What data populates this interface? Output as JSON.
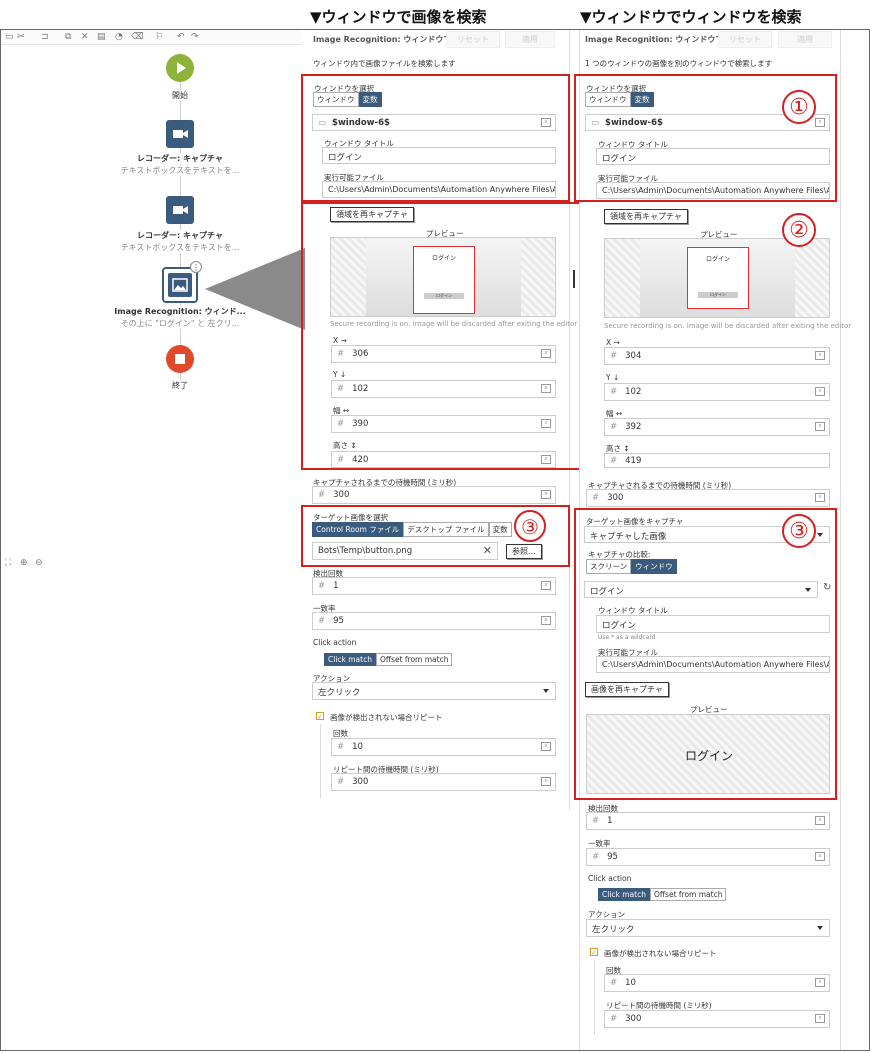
{
  "headers": {
    "left": "▼ウィンドウで画像を検索",
    "right": "▼ウィンドウでウィンドウを検索"
  },
  "canvas": {
    "nodes": [
      {
        "title": "開始",
        "subtitle": ""
      },
      {
        "title": "レコーダー: キャプチャ",
        "subtitle": "テキストボックスをテキストを..."
      },
      {
        "title": "レコーダー: キャプチャ",
        "subtitle": "テキストボックスをテキストを..."
      },
      {
        "title": "Image Recognition: ウィンド...",
        "subtitle": "その上に \"ログイン\" と 左クリ..."
      },
      {
        "title": "終了",
        "subtitle": ""
      }
    ],
    "colors": {
      "start": "#8db33a",
      "end": "#e04a2a",
      "node": "#3a5a7e"
    }
  },
  "left": {
    "title": "Image Recognition: ウィンドウで...",
    "reset": "リセット",
    "apply": "適用",
    "desc": "ウィンドウ内で画像ファイルを検索します",
    "window_select_label": "ウィンドウを選択",
    "seg_window": "ウィンドウ",
    "seg_variable": "変数",
    "window_var": "$window-6$",
    "window_title_label": "ウィンドウ タイトル",
    "window_title_value": "ログイン",
    "exe_label": "実行可能ファイル",
    "exe_value": "C:\\Users\\Admin\\Documents\\Automation Anywhere Files\\Au",
    "recapture_button": "領域を再キャプチャ",
    "preview_label": "プレビュー",
    "preview_login": "ログイン",
    "preview_btn": "ログイン",
    "secure_note": "Secure recording is on. Image will be discarded after exiting the editor",
    "x_label": "X →",
    "x_value": "306",
    "y_label": "Y ↓",
    "y_value": "102",
    "w_label": "幅 ↔",
    "w_value": "390",
    "h_label": "高さ ↕",
    "h_value": "420",
    "wait_label": "キャプチャされるまでの待機時間 (ミリ秒)",
    "wait_value": "300",
    "target_label": "ターゲット画像を選択",
    "tab_cr": "Control Room ファイル",
    "tab_desktop": "デスクトップ ファイル",
    "tab_var": "変数",
    "file_path": "Bots\\Temp\\button.png",
    "browse": "参照...",
    "count_label": "検出回数",
    "count_value": "1",
    "match_label": "一致率",
    "match_value": "95",
    "click_action_label": "Click action",
    "click_match": "Click match",
    "offset_match": "Offset from match",
    "action_label": "アクション",
    "action_value": "左クリック",
    "repeat_label": "画像が検出されない場合リピート",
    "times_label": "回数",
    "times_value": "10",
    "repeat_wait_label": "リピート間の待機時間 (ミリ秒)",
    "repeat_wait_value": "300"
  },
  "right": {
    "title": "Image Recognition: ウィンドウで...",
    "reset": "リセット",
    "apply": "適用",
    "desc": "1 つのウィンドウの画像を別のウィンドウで検索します",
    "window_select_label": "ウィンドウを選択",
    "seg_window": "ウィンドウ",
    "seg_variable": "変数",
    "window_var": "$window-6$",
    "window_title_label": "ウィンドウ タイトル",
    "window_title_value": "ログイン",
    "exe_label": "実行可能ファイル",
    "exe_value": "C:\\Users\\Admin\\Documents\\Automation Anywhere Files\\Au",
    "recapture_button": "領域を再キャプチャ",
    "preview_label": "プレビュー",
    "preview_login": "ログイン",
    "preview_btn": "ログイン",
    "secure_note": "Secure recording is on. Image will be discarded after exiting the editor",
    "x_label": "X →",
    "x_value": "304",
    "y_label": "Y ↓",
    "y_value": "102",
    "w_label": "幅 ↔",
    "w_value": "392",
    "h_label": "高さ ↕",
    "h_value": "419",
    "wait_label": "キャプチャされるまでの待機時間 (ミリ秒)",
    "wait_value": "300",
    "target_label": "ターゲット画像をキャプチャ",
    "target_value": "キャプチャした画像",
    "compare_label": "キャプチャの比較:",
    "seg_screen": "スクリーン",
    "seg_window2": "ウィンドウ",
    "window_select_value": "ログイン",
    "window_title_label2": "ウィンドウ タイトル",
    "window_title_value2": "ログイン",
    "wildcard_note": "Use * as a wildcard",
    "exe_label2": "実行可能ファイル",
    "exe_value2": "C:\\Users\\Admin\\Documents\\Automation Anywhere Files\\Au",
    "recapture_button2": "画像を再キャプチャ",
    "preview_label2": "プレビュー",
    "preview_text2": "ログイン",
    "count_label": "検出回数",
    "count_value": "1",
    "match_label": "一致率",
    "match_value": "95",
    "click_action_label": "Click action",
    "click_match": "Click match",
    "offset_match": "Offset from match",
    "action_label": "アクション",
    "action_value": "左クリック",
    "repeat_label": "画像が検出されない場合リピート",
    "times_label": "回数",
    "times_value": "10",
    "repeat_wait_label": "リピート間の待機時間 (ミリ秒)",
    "repeat_wait_value": "300"
  },
  "callouts": {
    "one": "①",
    "two": "②",
    "three": "③"
  },
  "colors": {
    "highlight": "#d61f1f",
    "segment_active": "#3a5a7e"
  }
}
